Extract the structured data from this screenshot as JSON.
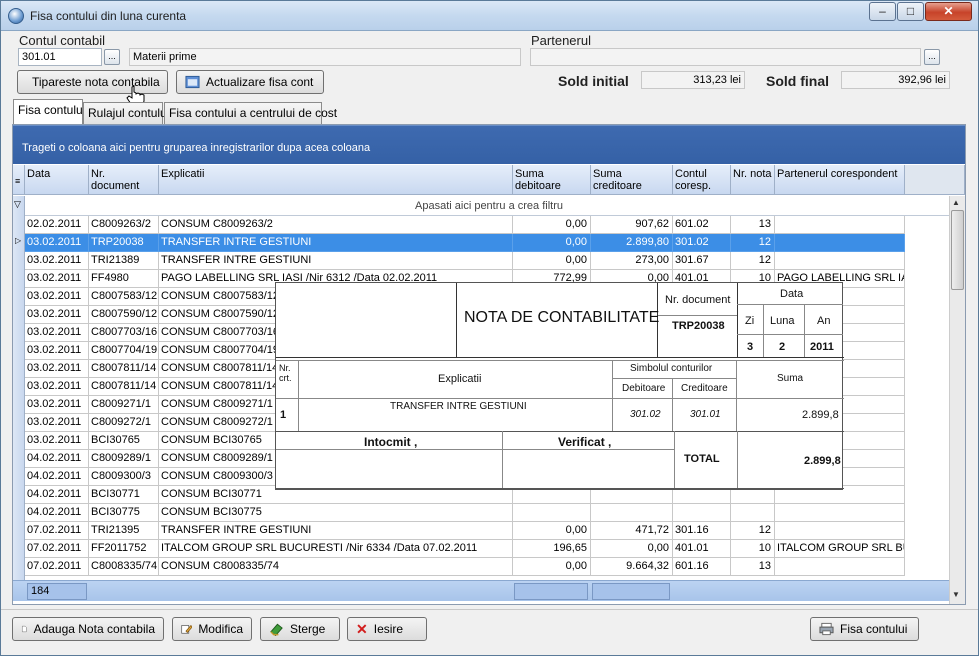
{
  "window": {
    "title": "Fisa contului din luna curenta",
    "controls": {
      "minimize": "–",
      "maximize": "□",
      "close": "✕"
    }
  },
  "account": {
    "label": "Contul contabil",
    "code": "301.01",
    "name": "Materii prime",
    "lookup": "..."
  },
  "partner": {
    "label": "Partenerul",
    "value": "",
    "lookup": "..."
  },
  "toolbar": {
    "print_label": "Tipareste nota contabila",
    "refresh_label": "Actualizare fisa cont"
  },
  "balances": {
    "initial_label": "Sold initial",
    "initial_value": "313,23 lei",
    "final_label": "Sold final",
    "final_value": "392,96 lei"
  },
  "tabs": [
    {
      "label": "Fisa contului"
    },
    {
      "label": "Rulajul contului"
    },
    {
      "label": "Fisa contului a centrului de cost"
    }
  ],
  "grid": {
    "group_hint": "Trageti o coloana aici pentru gruparea inregistrarilor dupa acea coloana",
    "filter_hint": "Apasati aici pentru a  crea filtru",
    "columns": [
      {
        "label": "Data"
      },
      {
        "label": "Nr. document"
      },
      {
        "label": "Explicatii"
      },
      {
        "label": "Suma debitoare"
      },
      {
        "label": "Suma creditoare"
      },
      {
        "label": "Contul coresp."
      },
      {
        "label": "Nr. nota"
      },
      {
        "label": "Partenerul corespondent"
      }
    ],
    "rows": [
      {
        "date": "02.02.2011",
        "doc": "C8009263/2",
        "expl": "CONSUM C8009263/2",
        "deb": "0,00",
        "cred": "907,62",
        "acct": "601.02",
        "nota": "13",
        "partner": ""
      },
      {
        "date": "03.02.2011",
        "doc": "TRP20038",
        "expl": "TRANSFER INTRE GESTIUNI",
        "deb": "0,00",
        "cred": "2.899,80",
        "acct": "301.02",
        "nota": "12",
        "partner": ""
      },
      {
        "date": "03.02.2011",
        "doc": "TRI21389",
        "expl": "TRANSFER INTRE GESTIUNI",
        "deb": "0,00",
        "cred": "273,00",
        "acct": "301.67",
        "nota": "12",
        "partner": ""
      },
      {
        "date": "03.02.2011",
        "doc": "FF4980",
        "expl": "PAGO LABELLING SRL IASI /Nir 6312 /Data 02.02.2011",
        "deb": "772,99",
        "cred": "0,00",
        "acct": "401.01",
        "nota": "10",
        "partner": "PAGO LABELLING SRL IA"
      },
      {
        "date": "03.02.2011",
        "doc": "C8007583/12",
        "expl": "CONSUM C8007583/12",
        "deb": "",
        "cred": "",
        "acct": "",
        "nota": "",
        "partner": ""
      },
      {
        "date": "03.02.2011",
        "doc": "C8007590/12",
        "expl": "CONSUM C8007590/12",
        "deb": "",
        "cred": "",
        "acct": "",
        "nota": "",
        "partner": ""
      },
      {
        "date": "03.02.2011",
        "doc": "C8007703/16",
        "expl": "CONSUM C8007703/16",
        "deb": "",
        "cred": "",
        "acct": "",
        "nota": "",
        "partner": ""
      },
      {
        "date": "03.02.2011",
        "doc": "C8007704/19",
        "expl": "CONSUM C8007704/19",
        "deb": "",
        "cred": "",
        "acct": "",
        "nota": "",
        "partner": ""
      },
      {
        "date": "03.02.2011",
        "doc": "C8007811/14",
        "expl": "CONSUM C8007811/14",
        "deb": "",
        "cred": "",
        "acct": "",
        "nota": "",
        "partner": ""
      },
      {
        "date": "03.02.2011",
        "doc": "C8007811/14",
        "expl": "CONSUM C8007811/14",
        "deb": "",
        "cred": "",
        "acct": "",
        "nota": "",
        "partner": ""
      },
      {
        "date": "03.02.2011",
        "doc": "C8009271/1",
        "expl": "CONSUM C8009271/1",
        "deb": "",
        "cred": "",
        "acct": "",
        "nota": "",
        "partner": ""
      },
      {
        "date": "03.02.2011",
        "doc": "C8009272/1",
        "expl": "CONSUM C8009272/1",
        "deb": "",
        "cred": "",
        "acct": "",
        "nota": "",
        "partner": ""
      },
      {
        "date": "03.02.2011",
        "doc": "BCI30765",
        "expl": "CONSUM BCI30765",
        "deb": "",
        "cred": "",
        "acct": "",
        "nota": "",
        "partner": ""
      },
      {
        "date": "04.02.2011",
        "doc": "C8009289/1",
        "expl": "CONSUM C8009289/1",
        "deb": "",
        "cred": "",
        "acct": "",
        "nota": "",
        "partner": ""
      },
      {
        "date": "04.02.2011",
        "doc": "C8009300/3",
        "expl": "CONSUM C8009300/3",
        "deb": "",
        "cred": "",
        "acct": "",
        "nota": "",
        "partner": ""
      },
      {
        "date": "04.02.2011",
        "doc": "BCI30771",
        "expl": "CONSUM BCI30771",
        "deb": "",
        "cred": "",
        "acct": "",
        "nota": "",
        "partner": ""
      },
      {
        "date": "04.02.2011",
        "doc": "BCI30775",
        "expl": "CONSUM BCI30775",
        "deb": "",
        "cred": "",
        "acct": "",
        "nota": "",
        "partner": ""
      },
      {
        "date": "07.02.2011",
        "doc": "TRI21395",
        "expl": "TRANSFER INTRE GESTIUNI",
        "deb": "0,00",
        "cred": "471,72",
        "acct": "301.16",
        "nota": "12",
        "partner": ""
      },
      {
        "date": "07.02.2011",
        "doc": "FF2011752",
        "expl": "ITALCOM GROUP SRL BUCURESTI /Nir 6334  /Data 07.02.2011",
        "deb": "196,65",
        "cred": "0,00",
        "acct": "401.01",
        "nota": "10",
        "partner": "ITALCOM GROUP SRL BU"
      },
      {
        "date": "07.02.2011",
        "doc": "C8008335/74",
        "expl": "CONSUM C8008335/74",
        "deb": "0,00",
        "cred": "9.664,32",
        "acct": "601.16",
        "nota": "13",
        "partner": ""
      }
    ],
    "footer_count": "184"
  },
  "voucher": {
    "title": "NOTA DE CONTABILITATE",
    "doc_label": "Nr. document",
    "doc_value": "TRP20038",
    "date_label": "Data",
    "day_label": "Zi",
    "month_label": "Luna",
    "year_label": "An",
    "day": "3",
    "month": "2",
    "year": "2011",
    "col_nr": "Nr. crt.",
    "col_expl": "Explicatii",
    "col_symbol": "Simbolul conturilor",
    "col_deb": "Debitoare",
    "col_cred": "Creditoare",
    "col_sum": "Suma",
    "line_nr": "1",
    "line_expl": "TRANSFER INTRE GESTIUNI",
    "line_deb": "301.02",
    "line_cred": "301.01",
    "line_sum": "2.899,8",
    "prepared_label": "Intocmit ,",
    "checked_label": "Verificat ,",
    "total_label": "TOTAL",
    "total_value": "2.899,8"
  },
  "actions": {
    "add_label": "Adauga Nota contabila",
    "edit_label": "Modifica",
    "delete_label": "Sterge",
    "exit_label": "Iesire",
    "sheet_label": "Fisa contului"
  },
  "colors": {
    "group_bar": "#3561a6",
    "selection": "#3c8ee6",
    "header": "#c8d8f0"
  }
}
